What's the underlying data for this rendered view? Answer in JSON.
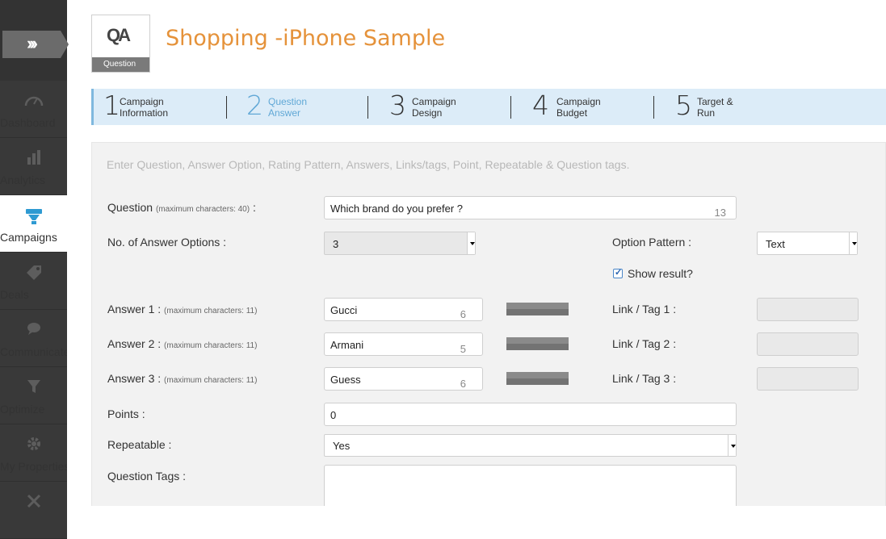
{
  "sidebar": {
    "expand_icon": "double-chevron-right-icon",
    "items": [
      {
        "label": "Dashboard",
        "icon": "speedometer-icon",
        "active": false
      },
      {
        "label": "Analytics",
        "icon": "bar-chart-icon",
        "active": false
      },
      {
        "label": "Campaigns",
        "icon": "campaign-icon",
        "active": true
      },
      {
        "label": "Deals",
        "icon": "tag-icon",
        "active": false
      },
      {
        "label": "Communicate",
        "icon": "chat-bubble-icon",
        "active": false
      },
      {
        "label": "Optimize",
        "icon": "funnel-icon",
        "active": false
      },
      {
        "label": "My Properties",
        "icon": "gear-icon",
        "active": false
      },
      {
        "label": "",
        "icon": "tools-icon",
        "active": false
      }
    ],
    "active_color": "#2e9ad2"
  },
  "header": {
    "badge_letters": "QA",
    "badge_label": "Question",
    "title": "Shopping -iPhone Sample",
    "title_color": "#e5923a"
  },
  "steps": [
    {
      "num": "1",
      "line1": "Campaign",
      "line2": "Information",
      "active": false
    },
    {
      "num": "2",
      "line1": "Question",
      "line2": "Answer",
      "active": true
    },
    {
      "num": "3",
      "line1": "Campaign",
      "line2": "Design",
      "active": false
    },
    {
      "num": "4",
      "line1": "Campaign",
      "line2": "Budget",
      "active": false
    },
    {
      "num": "5",
      "line1": "Target &",
      "line2": "Run",
      "active": false
    }
  ],
  "form": {
    "hint": "Enter Question, Answer Option, Rating Pattern, Answers, Links/tags, Point, Repeatable & Question tags.",
    "question": {
      "label": "Question",
      "note": "(maximum characters: 40)",
      "suffix": " :",
      "value": "Which brand do you prefer ?",
      "count": "13"
    },
    "answer_options": {
      "label": "No. of Answer Options :",
      "value": "3"
    },
    "option_pattern": {
      "label": "Option Pattern :",
      "value": "Text"
    },
    "show_result": {
      "label": "Show result?",
      "checked": true
    },
    "answers": [
      {
        "label": "Answer 1 :",
        "note": "(maximum characters: 11)",
        "value": "Gucci",
        "count": "6",
        "link_label": "Link / Tag 1 :"
      },
      {
        "label": "Answer 2 :",
        "note": "(maximum characters: 11)",
        "value": "Armani",
        "count": "5",
        "link_label": "Link / Tag 2 :"
      },
      {
        "label": "Answer 3 :",
        "note": "(maximum characters: 11)",
        "value": "Guess",
        "count": "6",
        "link_label": "Link / Tag 3 :"
      }
    ],
    "points": {
      "label": "Points :",
      "value": "0"
    },
    "repeatable": {
      "label": "Repeatable :",
      "value": "Yes"
    },
    "question_tags": {
      "label": "Question Tags :",
      "value": ""
    }
  }
}
